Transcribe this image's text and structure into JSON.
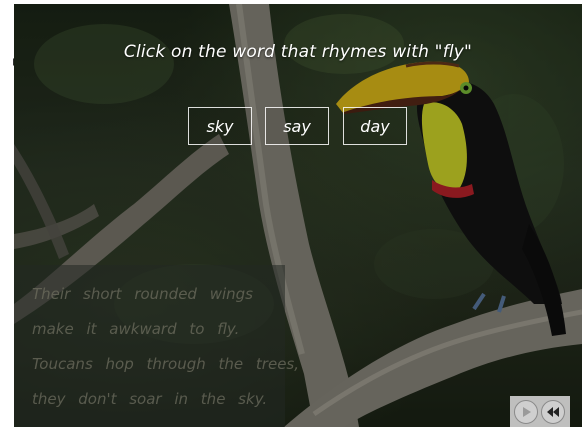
{
  "prompt": "Click on the word that rhymes with \"fly\"",
  "choices": [
    "sky",
    "say",
    "day"
  ],
  "poem": [
    "Their short rounded wings",
    "make it awkward to fly.",
    "Toucans hop through the trees,",
    "they don't soar in the sky."
  ],
  "nav": {
    "play_icon": "play-icon",
    "rewind_icon": "rewind-icon"
  },
  "colors": {
    "text": "#ffffff",
    "beak_yellow": "#e8c21a",
    "throat_yellow": "#d9e02a",
    "plumage": "#141414"
  }
}
